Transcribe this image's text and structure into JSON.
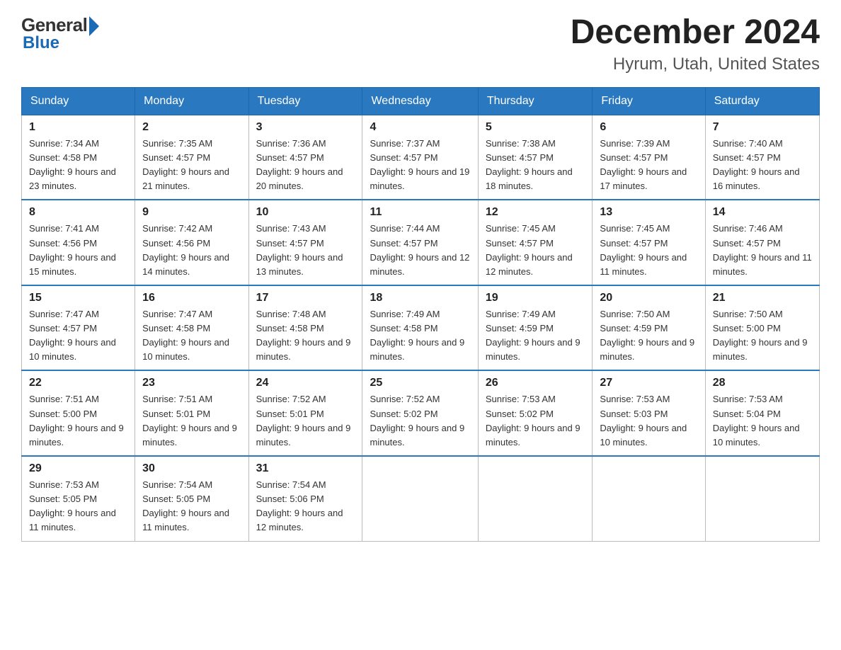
{
  "logo": {
    "general": "General",
    "blue": "Blue"
  },
  "header": {
    "month": "December 2024",
    "location": "Hyrum, Utah, United States"
  },
  "days_of_week": [
    "Sunday",
    "Monday",
    "Tuesday",
    "Wednesday",
    "Thursday",
    "Friday",
    "Saturday"
  ],
  "weeks": [
    [
      {
        "day": "1",
        "sunrise": "7:34 AM",
        "sunset": "4:58 PM",
        "daylight": "9 hours and 23 minutes."
      },
      {
        "day": "2",
        "sunrise": "7:35 AM",
        "sunset": "4:57 PM",
        "daylight": "9 hours and 21 minutes."
      },
      {
        "day": "3",
        "sunrise": "7:36 AM",
        "sunset": "4:57 PM",
        "daylight": "9 hours and 20 minutes."
      },
      {
        "day": "4",
        "sunrise": "7:37 AM",
        "sunset": "4:57 PM",
        "daylight": "9 hours and 19 minutes."
      },
      {
        "day": "5",
        "sunrise": "7:38 AM",
        "sunset": "4:57 PM",
        "daylight": "9 hours and 18 minutes."
      },
      {
        "day": "6",
        "sunrise": "7:39 AM",
        "sunset": "4:57 PM",
        "daylight": "9 hours and 17 minutes."
      },
      {
        "day": "7",
        "sunrise": "7:40 AM",
        "sunset": "4:57 PM",
        "daylight": "9 hours and 16 minutes."
      }
    ],
    [
      {
        "day": "8",
        "sunrise": "7:41 AM",
        "sunset": "4:56 PM",
        "daylight": "9 hours and 15 minutes."
      },
      {
        "day": "9",
        "sunrise": "7:42 AM",
        "sunset": "4:56 PM",
        "daylight": "9 hours and 14 minutes."
      },
      {
        "day": "10",
        "sunrise": "7:43 AM",
        "sunset": "4:57 PM",
        "daylight": "9 hours and 13 minutes."
      },
      {
        "day": "11",
        "sunrise": "7:44 AM",
        "sunset": "4:57 PM",
        "daylight": "9 hours and 12 minutes."
      },
      {
        "day": "12",
        "sunrise": "7:45 AM",
        "sunset": "4:57 PM",
        "daylight": "9 hours and 12 minutes."
      },
      {
        "day": "13",
        "sunrise": "7:45 AM",
        "sunset": "4:57 PM",
        "daylight": "9 hours and 11 minutes."
      },
      {
        "day": "14",
        "sunrise": "7:46 AM",
        "sunset": "4:57 PM",
        "daylight": "9 hours and 11 minutes."
      }
    ],
    [
      {
        "day": "15",
        "sunrise": "7:47 AM",
        "sunset": "4:57 PM",
        "daylight": "9 hours and 10 minutes."
      },
      {
        "day": "16",
        "sunrise": "7:47 AM",
        "sunset": "4:58 PM",
        "daylight": "9 hours and 10 minutes."
      },
      {
        "day": "17",
        "sunrise": "7:48 AM",
        "sunset": "4:58 PM",
        "daylight": "9 hours and 9 minutes."
      },
      {
        "day": "18",
        "sunrise": "7:49 AM",
        "sunset": "4:58 PM",
        "daylight": "9 hours and 9 minutes."
      },
      {
        "day": "19",
        "sunrise": "7:49 AM",
        "sunset": "4:59 PM",
        "daylight": "9 hours and 9 minutes."
      },
      {
        "day": "20",
        "sunrise": "7:50 AM",
        "sunset": "4:59 PM",
        "daylight": "9 hours and 9 minutes."
      },
      {
        "day": "21",
        "sunrise": "7:50 AM",
        "sunset": "5:00 PM",
        "daylight": "9 hours and 9 minutes."
      }
    ],
    [
      {
        "day": "22",
        "sunrise": "7:51 AM",
        "sunset": "5:00 PM",
        "daylight": "9 hours and 9 minutes."
      },
      {
        "day": "23",
        "sunrise": "7:51 AM",
        "sunset": "5:01 PM",
        "daylight": "9 hours and 9 minutes."
      },
      {
        "day": "24",
        "sunrise": "7:52 AM",
        "sunset": "5:01 PM",
        "daylight": "9 hours and 9 minutes."
      },
      {
        "day": "25",
        "sunrise": "7:52 AM",
        "sunset": "5:02 PM",
        "daylight": "9 hours and 9 minutes."
      },
      {
        "day": "26",
        "sunrise": "7:53 AM",
        "sunset": "5:02 PM",
        "daylight": "9 hours and 9 minutes."
      },
      {
        "day": "27",
        "sunrise": "7:53 AM",
        "sunset": "5:03 PM",
        "daylight": "9 hours and 10 minutes."
      },
      {
        "day": "28",
        "sunrise": "7:53 AM",
        "sunset": "5:04 PM",
        "daylight": "9 hours and 10 minutes."
      }
    ],
    [
      {
        "day": "29",
        "sunrise": "7:53 AM",
        "sunset": "5:05 PM",
        "daylight": "9 hours and 11 minutes."
      },
      {
        "day": "30",
        "sunrise": "7:54 AM",
        "sunset": "5:05 PM",
        "daylight": "9 hours and 11 minutes."
      },
      {
        "day": "31",
        "sunrise": "7:54 AM",
        "sunset": "5:06 PM",
        "daylight": "9 hours and 12 minutes."
      },
      null,
      null,
      null,
      null
    ]
  ]
}
